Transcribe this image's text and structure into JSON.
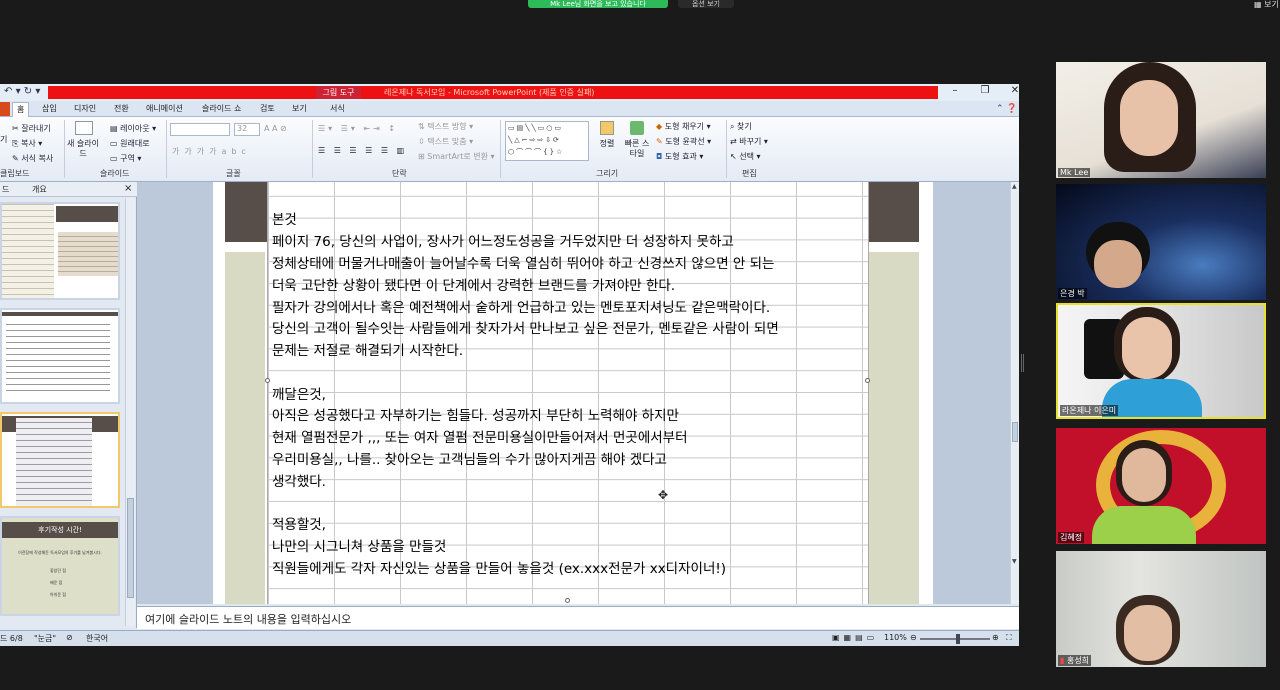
{
  "zoom_meeting": {
    "share_banner": "Mk Lee님 화면을 보고 있습니다",
    "stop_label": "옵션 보기",
    "view_label": "보기"
  },
  "ppt": {
    "contextual_tab": "그림 도구",
    "window_title": "레온제나 독서모임 - Microsoft PowerPoint (제품 인증 실패)",
    "tabs": [
      "홈",
      "삽입",
      "디자인",
      "전환",
      "애니메이션",
      "슬라이드 쇼",
      "검토",
      "보기",
      "서식"
    ],
    "ribbon": {
      "clipboard": {
        "cut": "잘라내기",
        "copy": "복사",
        "format_painter": "서식 복사",
        "label": "클립보드",
        "paste_short": "기"
      },
      "slides": {
        "new_slide": "새 슬라이드",
        "layout": "레이아웃",
        "reset": "원래대로",
        "section": "구역",
        "label": "슬라이드"
      },
      "font": {
        "size": "32",
        "label": "글꼴"
      },
      "paragraph": {
        "text_direction": "텍스트 방향",
        "text_align": "텍스트 맞춤",
        "smartart": "SmartArt로 변환",
        "label": "단락"
      },
      "drawing": {
        "arrange": "정렬",
        "quick_styles": "빠른 스타일",
        "fill": "도형 채우기",
        "outline": "도형 윤곽선",
        "effects": "도형 효과",
        "label": "그리기"
      },
      "editing": {
        "find": "찾기",
        "replace": "바꾸기",
        "select": "선택",
        "label": "편집"
      }
    },
    "left_pane": {
      "tab_slides": "드",
      "tab_outline": "개요",
      "close": "×",
      "thumb4_title": "후기작성 시간!",
      "thumb4_line": "이전장에 작성해둔 독서모임의 후기를 남겨봅시다.",
      "thumb4_items": [
        "좋았던 점",
        "배운 점",
        "아쉬운 점"
      ]
    },
    "slide_lines": [
      "본것",
      "페이지 76, 당신의 사업이, 장사가 어느정도성공을 거두었지만 더 성장하지 못하고",
      "정체상태에 머물거나매출이 늘어날수록 더욱 열심히 뛰어야 하고 신경쓰지 않으면 안 되는",
      "더욱 고단한 상황이 됐다면 이 단계에서 강력한 브랜드를 가져야만 한다.",
      "필자가 강의에서나 혹은 예전책에서 숱하게 언급하고 있는 멘토포지셔닝도 같은맥락이다.",
      "당신의 고객이 될수잇는 사람들에게 찾자가서 만나보고 싶은 전문가, 멘토같은 사람이 되면",
      "문제는 저절로 해결되기 시작한다.",
      "",
      "깨달은것,",
      "아직은 성공했다고 자부하기는 힘들다. 성공까지 부단히 노력해야 하지만",
      "현재 열펌전문가 ,,, 또는 여자 열펌 전문미용실이만들어져서 먼곳에서부터",
      "우리미용실,, 나를.. 찾아오는 고객님들의 수가 많아지게끔 해야 겠다고",
      "생각했다.",
      "",
      "적용할것,",
      "나만의 시그니쳐 상품을 만들것",
      "직원들에게도 각자 자신있는 상품을 만들어 놓을것 (ex.xxx전문가 xx디자이너!)"
    ],
    "notes_placeholder": "여기에 슬라이드 노트의 내용을 입력하십시오",
    "status": {
      "slide": "드 6/8",
      "theme": "\"눈금\"",
      "language": "한국어",
      "zoom": "110%"
    }
  },
  "participants": [
    {
      "name": "Mk Lee"
    },
    {
      "name": "은경 박"
    },
    {
      "name": "라온제나 이은미",
      "active": true
    },
    {
      "name": "김혜정"
    },
    {
      "name": "홍성희"
    }
  ]
}
